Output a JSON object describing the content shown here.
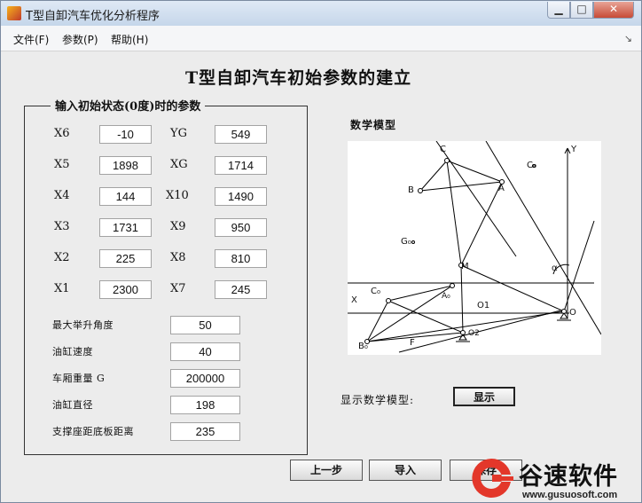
{
  "window": {
    "title": "T型自卸汽车优化分析程序",
    "min_glyph": "▁",
    "max_glyph": "□",
    "close_glyph": "✕"
  },
  "menu": {
    "items": [
      "文件(F)",
      "参数(P)",
      "帮助(H)"
    ],
    "overflow_arrow": "↘"
  },
  "heading": "T型自卸汽车初始参数的建立",
  "group": {
    "title": "输入初始状态(0度)时的参数",
    "rows": [
      {
        "left_label": "X6",
        "left_value": "-10",
        "right_label": "YG",
        "right_value": "549"
      },
      {
        "left_label": "X5",
        "left_value": "1898",
        "right_label": "XG",
        "right_value": "1714"
      },
      {
        "left_label": "X4",
        "left_value": "144",
        "right_label": "X10",
        "right_value": "1490"
      },
      {
        "left_label": "X3",
        "left_value": "1731",
        "right_label": "X9",
        "right_value": "950"
      },
      {
        "left_label": "X2",
        "left_value": "225",
        "right_label": "X8",
        "right_value": "810"
      },
      {
        "left_label": "X1",
        "left_value": "2300",
        "right_label": "X7",
        "right_value": "245"
      }
    ],
    "params": [
      {
        "label": "最大举升角度",
        "value": "50"
      },
      {
        "label": "油缸速度",
        "value": "40"
      },
      {
        "label": "车厢重量  G",
        "value": "200000"
      },
      {
        "label": "油缸直径",
        "value": "198"
      },
      {
        "label": "支撑座距底板距离",
        "value": "235"
      }
    ]
  },
  "model": {
    "label": "数学模型",
    "show_label": "显示数学模型:",
    "show_button": "显示",
    "diagram_labels": {
      "C": "C",
      "Co": "C₀",
      "B": "B",
      "A": "A",
      "Go": "G₀",
      "M": "M",
      "Y": "Y",
      "X": "X",
      "O": "O",
      "O1": "O1",
      "O2": "O2",
      "alpha": "α",
      "Bo": "B₀",
      "F": "F",
      "Ao": "A₀"
    }
  },
  "buttons": {
    "prev": "上一步",
    "import": "导入",
    "save": "保存"
  },
  "watermark": {
    "brand": "谷速软件",
    "url": "www.gusuosoft.com"
  }
}
